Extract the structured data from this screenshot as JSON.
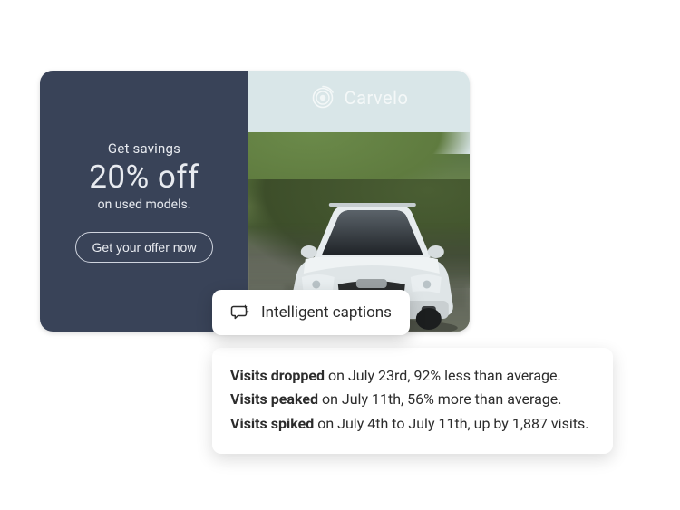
{
  "ad": {
    "left": {
      "heading_small": "Get savings",
      "heading_large": "20% off",
      "sub": "on used models.",
      "cta": "Get your offer now"
    },
    "brand": {
      "name": "Carvelo"
    }
  },
  "captions_chip": {
    "label": "Intelligent captions"
  },
  "insights": [
    {
      "bold": "Visits dropped",
      "rest": " on July 23rd, 92% less than average."
    },
    {
      "bold": "Visits peaked",
      "rest": " on July 11th, 56% more than average."
    },
    {
      "bold": "Visits spiked",
      "rest": " on July 4th to July 11th, up by 1,887 visits."
    }
  ]
}
